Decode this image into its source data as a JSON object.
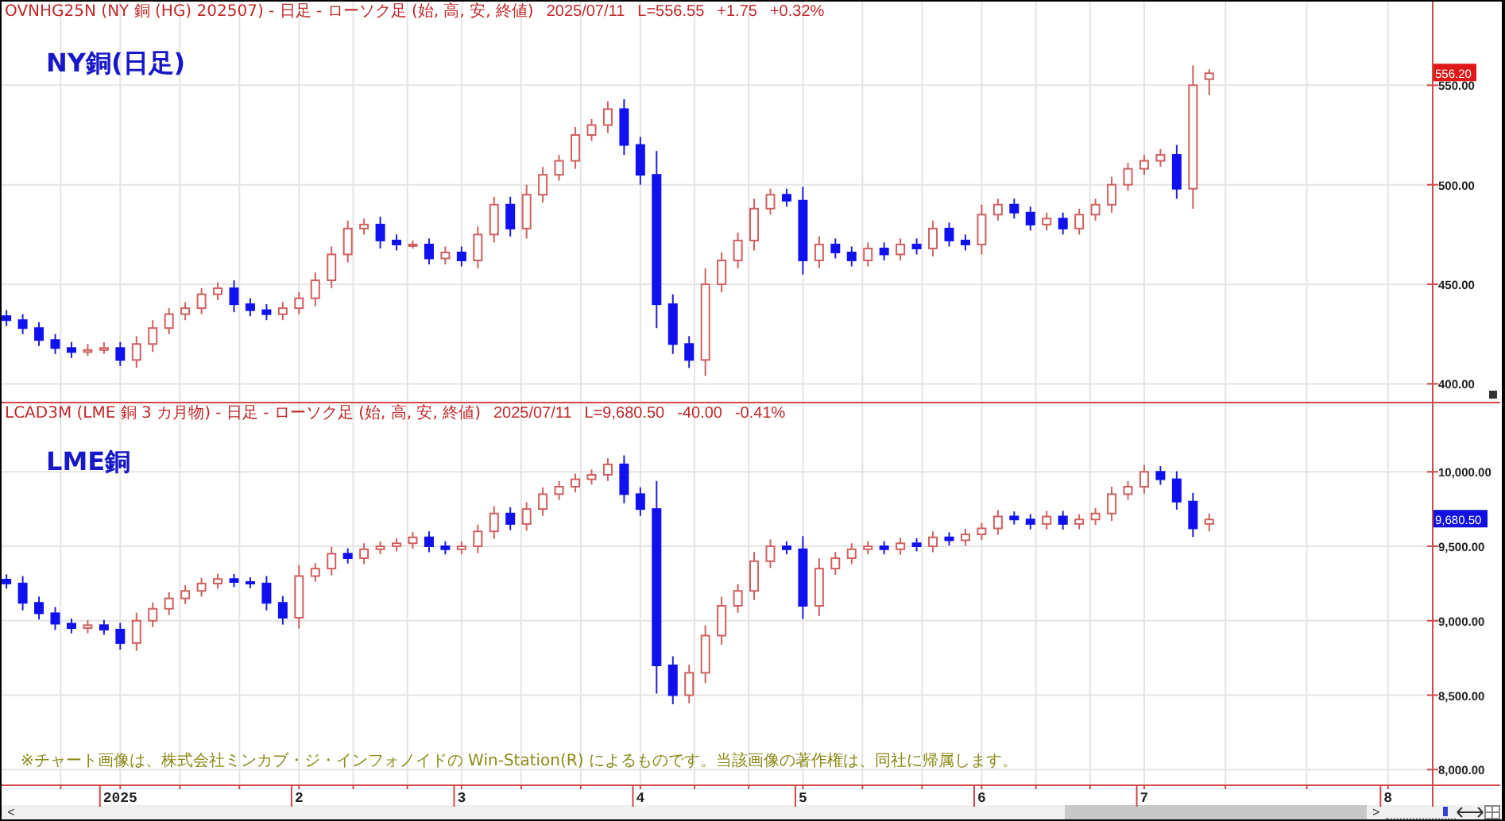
{
  "panels": [
    {
      "header": {
        "symbol_line": "OVNHG25N (NY 銅 (HG) 202507) - 日足 - ローソク足 (始, 高, 安, 終値)",
        "date": "2025/07/11",
        "last": "L=556.55",
        "change": "+1.75",
        "change_pct": "+0.32%"
      },
      "title": "NY銅(日足)",
      "price_tag": {
        "text": "556.20",
        "color": "#e01818"
      },
      "chart_data": {
        "type": "candlestick",
        "grid": true,
        "ylim": [
          391,
          592
        ],
        "yticks": [
          {
            "value": 400,
            "label": "400.00"
          },
          {
            "value": 450,
            "label": "450.00"
          },
          {
            "value": 500,
            "label": "500.00"
          },
          {
            "value": 550,
            "label": "550.00"
          }
        ],
        "categories": [
          null,
          null,
          null,
          null,
          null,
          null,
          null,
          null,
          null,
          null,
          null,
          null,
          null,
          null,
          null,
          null,
          null,
          null,
          null,
          null,
          null,
          null,
          null,
          null,
          null,
          null,
          null,
          null,
          null,
          null,
          null,
          null,
          null,
          null,
          null,
          null,
          null,
          null,
          null,
          null,
          null,
          null,
          null,
          null,
          null,
          null,
          null,
          null,
          null,
          null,
          null,
          null,
          null,
          null,
          null,
          null,
          null,
          null,
          null,
          null,
          null,
          null,
          null,
          null,
          null,
          null,
          null,
          null,
          null,
          null,
          null,
          null,
          null,
          null,
          null,
          null,
          null,
          null,
          null,
          null,
          null,
          null,
          null,
          null,
          null,
          null
        ],
        "ohlc": [
          [
            434,
            437,
            429,
            432
          ],
          [
            432,
            435,
            425,
            428
          ],
          [
            428,
            431,
            419,
            422
          ],
          [
            422,
            425,
            415,
            418
          ],
          [
            418,
            421,
            413,
            416
          ],
          [
            416,
            420,
            414,
            417
          ],
          [
            417,
            421,
            415,
            418
          ],
          [
            418,
            421,
            409,
            412
          ],
          [
            412,
            424,
            408,
            420
          ],
          [
            420,
            432,
            416,
            428
          ],
          [
            428,
            438,
            425,
            435
          ],
          [
            435,
            441,
            432,
            438
          ],
          [
            438,
            448,
            435,
            445
          ],
          [
            445,
            451,
            442,
            448
          ],
          [
            448,
            452,
            436,
            440
          ],
          [
            440,
            443,
            434,
            437
          ],
          [
            437,
            440,
            432,
            435
          ],
          [
            435,
            441,
            432,
            438
          ],
          [
            438,
            446,
            435,
            443
          ],
          [
            443,
            456,
            439,
            452
          ],
          [
            452,
            469,
            448,
            465
          ],
          [
            465,
            482,
            461,
            478
          ],
          [
            478,
            483,
            475,
            480
          ],
          [
            480,
            484,
            468,
            472
          ],
          [
            472,
            475,
            467,
            470
          ],
          [
            470,
            472,
            468,
            470
          ],
          [
            470,
            473,
            460,
            463
          ],
          [
            463,
            469,
            460,
            466
          ],
          [
            466,
            469,
            459,
            462
          ],
          [
            462,
            479,
            458,
            475
          ],
          [
            475,
            494,
            471,
            490
          ],
          [
            490,
            494,
            474,
            478
          ],
          [
            478,
            500,
            473,
            495
          ],
          [
            495,
            509,
            491,
            505
          ],
          [
            505,
            515,
            502,
            512
          ],
          [
            512,
            529,
            508,
            525
          ],
          [
            525,
            533,
            522,
            530
          ],
          [
            530,
            542,
            526,
            538
          ],
          [
            538,
            543,
            515,
            520
          ],
          [
            520,
            524,
            500,
            505
          ],
          [
            505,
            517,
            428,
            440
          ],
          [
            440,
            445,
            415,
            420
          ],
          [
            420,
            424,
            408,
            412
          ],
          [
            412,
            458,
            404,
            450
          ],
          [
            450,
            466,
            446,
            462
          ],
          [
            462,
            476,
            458,
            472
          ],
          [
            472,
            493,
            467,
            488
          ],
          [
            488,
            498,
            485,
            495
          ],
          [
            495,
            498,
            489,
            492
          ],
          [
            492,
            499,
            455,
            462
          ],
          [
            462,
            474,
            458,
            470
          ],
          [
            470,
            473,
            463,
            466
          ],
          [
            466,
            469,
            459,
            462
          ],
          [
            462,
            471,
            459,
            468
          ],
          [
            468,
            471,
            462,
            465
          ],
          [
            465,
            473,
            462,
            470
          ],
          [
            470,
            473,
            465,
            468
          ],
          [
            468,
            482,
            464,
            478
          ],
          [
            478,
            481,
            469,
            472
          ],
          [
            472,
            475,
            467,
            470
          ],
          [
            470,
            490,
            465,
            485
          ],
          [
            485,
            493,
            482,
            490
          ],
          [
            490,
            493,
            483,
            486
          ],
          [
            486,
            489,
            477,
            480
          ],
          [
            480,
            486,
            477,
            483
          ],
          [
            483,
            486,
            475,
            478
          ],
          [
            478,
            488,
            475,
            485
          ],
          [
            485,
            493,
            482,
            490
          ],
          [
            490,
            504,
            486,
            500
          ],
          [
            500,
            511,
            497,
            508
          ],
          [
            508,
            515,
            505,
            512
          ],
          [
            512,
            518,
            509,
            515
          ],
          [
            515,
            520,
            493,
            498
          ],
          [
            498,
            560,
            488,
            550
          ],
          [
            553,
            558,
            545,
            556
          ],
          null,
          null,
          null,
          null,
          null,
          null,
          null,
          null,
          null,
          null,
          null
        ]
      }
    },
    {
      "header": {
        "symbol_line": "LCAD3M (LME 銅 3 カ月物) - 日足 - ローソク足 (始, 高, 安, 終値)",
        "date": "2025/07/11",
        "last": "L=9,680.50",
        "change": "-40.00",
        "change_pct": "-0.41%"
      },
      "title": "LME銅",
      "price_tag": {
        "text": "9,680.50",
        "color": "#1010e0"
      },
      "note": "※チャート画像は、株式会社ミンカブ・ジ・インフォノイドの Win-Station(R) によるものです。当該画像の著作権は、同社に帰属します。",
      "chart_data": {
        "type": "candlestick",
        "grid": true,
        "ylim": [
          7900,
          10460
        ],
        "yticks": [
          {
            "value": 8000,
            "label": "8,000.00"
          },
          {
            "value": 8500,
            "label": "8,500.00"
          },
          {
            "value": 9000,
            "label": "9,000.00"
          },
          {
            "value": 9500,
            "label": "9,500.00"
          },
          {
            "value": 10000,
            "label": "10,000.00"
          }
        ],
        "categories": [
          null,
          null,
          null,
          null,
          null,
          null,
          null,
          "2025",
          null,
          null,
          null,
          null,
          null,
          null,
          null,
          null,
          null,
          null,
          "2",
          null,
          null,
          null,
          null,
          null,
          null,
          null,
          null,
          null,
          "3",
          null,
          null,
          null,
          null,
          null,
          null,
          null,
          null,
          null,
          null,
          "4",
          null,
          null,
          null,
          null,
          null,
          null,
          null,
          null,
          null,
          "5",
          null,
          null,
          null,
          null,
          null,
          null,
          null,
          null,
          null,
          null,
          "6",
          null,
          null,
          null,
          null,
          null,
          null,
          null,
          null,
          null,
          "7",
          null,
          null,
          null,
          null,
          null,
          null,
          null,
          null,
          null,
          null,
          null,
          null,
          null,
          null,
          "8"
        ],
        "ohlc": [
          [
            9276,
            9311,
            9215,
            9250
          ],
          [
            9250,
            9300,
            9069,
            9120
          ],
          [
            9120,
            9162,
            9008,
            9050
          ],
          [
            9050,
            9092,
            8938,
            8980
          ],
          [
            8980,
            9015,
            8915,
            8950
          ],
          [
            8950,
            9004,
            8916,
            8970
          ],
          [
            8970,
            9005,
            8905,
            8940
          ],
          [
            8940,
            8985,
            8806,
            8850
          ],
          [
            8850,
            9054,
            8797,
            9000
          ],
          [
            9000,
            9123,
            8957,
            9080
          ],
          [
            9080,
            9192,
            9038,
            9150
          ],
          [
            9150,
            9238,
            9112,
            9200
          ],
          [
            9200,
            9288,
            9162,
            9250
          ],
          [
            9250,
            9316,
            9214,
            9280
          ],
          [
            9280,
            9314,
            9226,
            9260
          ],
          [
            9260,
            9292,
            9218,
            9250
          ],
          [
            9250,
            9300,
            9069,
            9120
          ],
          [
            9120,
            9166,
            8974,
            9020
          ],
          [
            9020,
            9373,
            8947,
            9300
          ],
          [
            9300,
            9388,
            9262,
            9350
          ],
          [
            9350,
            9496,
            9304,
            9450
          ],
          [
            9450,
            9486,
            9384,
            9420
          ],
          [
            9420,
            9520,
            9380,
            9480
          ],
          [
            9480,
            9534,
            9446,
            9500
          ],
          [
            9500,
            9554,
            9466,
            9520
          ],
          [
            9520,
            9597,
            9483,
            9560
          ],
          [
            9560,
            9600,
            9460,
            9500
          ],
          [
            9500,
            9534,
            9446,
            9480
          ],
          [
            9480,
            9534,
            9446,
            9500
          ],
          [
            9500,
            9646,
            9454,
            9600
          ],
          [
            9600,
            9769,
            9551,
            9720
          ],
          [
            9720,
            9762,
            9608,
            9650
          ],
          [
            9650,
            9796,
            9604,
            9750
          ],
          [
            9750,
            9896,
            9704,
            9850
          ],
          [
            9850,
            9938,
            9812,
            9900
          ],
          [
            9900,
            9988,
            9862,
            9950
          ],
          [
            9950,
            10016,
            9914,
            9980
          ],
          [
            9980,
            10092,
            9938,
            10050
          ],
          [
            10050,
            10111,
            9789,
            9850
          ],
          [
            9850,
            9896,
            9704,
            9750
          ],
          [
            9750,
            9939,
            8511,
            8700
          ],
          [
            8700,
            8761,
            8439,
            8500
          ],
          [
            8500,
            8704,
            8446,
            8650
          ],
          [
            8650,
            8969,
            8581,
            8900
          ],
          [
            8900,
            9161,
            8839,
            9100
          ],
          [
            9100,
            9246,
            9054,
            9200
          ],
          [
            9200,
            9461,
            9139,
            9400
          ],
          [
            9400,
            9546,
            9354,
            9500
          ],
          [
            9500,
            9534,
            9446,
            9480
          ],
          [
            9480,
            9568,
            9012,
            9100
          ],
          [
            9100,
            9419,
            9031,
            9350
          ],
          [
            9350,
            9462,
            9308,
            9420
          ],
          [
            9420,
            9520,
            9380,
            9480
          ],
          [
            9480,
            9534,
            9446,
            9500
          ],
          [
            9500,
            9534,
            9446,
            9480
          ],
          [
            9480,
            9557,
            9443,
            9520
          ],
          [
            9520,
            9554,
            9466,
            9500
          ],
          [
            9500,
            9600,
            9460,
            9560
          ],
          [
            9560,
            9594,
            9506,
            9540
          ],
          [
            9540,
            9617,
            9503,
            9580
          ],
          [
            9580,
            9657,
            9543,
            9620
          ],
          [
            9620,
            9743,
            9577,
            9700
          ],
          [
            9700,
            9734,
            9646,
            9680
          ],
          [
            9680,
            9716,
            9614,
            9650
          ],
          [
            9650,
            9738,
            9612,
            9700
          ],
          [
            9700,
            9738,
            9612,
            9650
          ],
          [
            9650,
            9716,
            9614,
            9680
          ],
          [
            9680,
            9757,
            9643,
            9720
          ],
          [
            9720,
            9900,
            9670,
            9850
          ],
          [
            9850,
            9938,
            9812,
            9900
          ],
          [
            9900,
            10046,
            9854,
            10000
          ],
          [
            10000,
            10038,
            9912,
            9950
          ],
          [
            9950,
            10004,
            9746,
            9800
          ],
          [
            9800,
            9858,
            9562,
            9620
          ],
          [
            9650,
            9720,
            9600,
            9680
          ],
          null,
          null,
          null,
          null,
          null,
          null,
          null,
          null,
          null,
          null,
          null
        ]
      }
    }
  ],
  "scrollbar": {
    "left": "<",
    "right": ">"
  },
  "zoom_slider": {
    "level": 0.85
  }
}
